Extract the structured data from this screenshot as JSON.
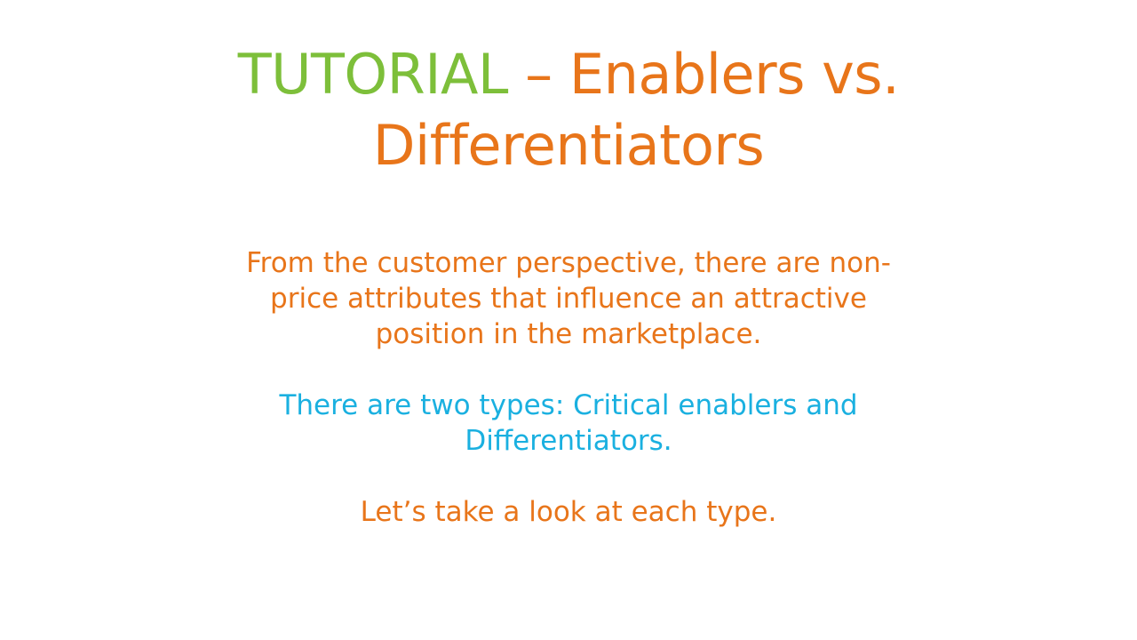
{
  "colors": {
    "green": "#7dbf3a",
    "orange": "#e8751a",
    "blue": "#1ab0e0",
    "background": "#ffffff"
  },
  "title": {
    "part1": "TUTORIAL",
    "separator": " – ",
    "part2_line1": "Enablers vs.",
    "part2_line2": "Differentiators"
  },
  "body": {
    "paragraph1": [
      "From the customer perspective, there are non-",
      "price attributes that influence an attractive",
      "position in the marketplace."
    ],
    "paragraph2": [
      "There are two types: Critical enablers and",
      "Differentiators."
    ],
    "paragraph3": [
      "Let’s take a look at each type."
    ]
  }
}
